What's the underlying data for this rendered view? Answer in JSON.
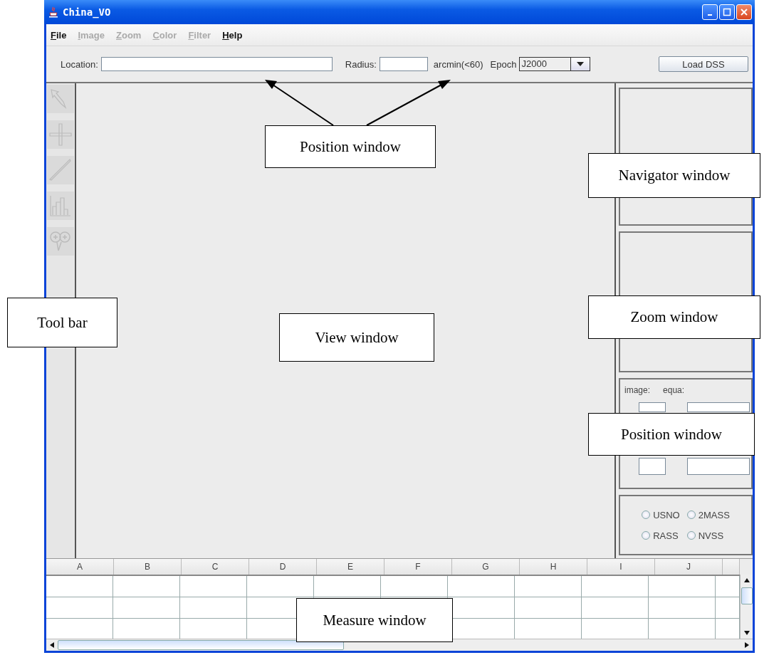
{
  "window": {
    "title": "China_VO"
  },
  "menu": [
    {
      "label": "File",
      "disabled": false
    },
    {
      "label": "Image",
      "disabled": true
    },
    {
      "label": "Zoom",
      "disabled": true
    },
    {
      "label": "Color",
      "disabled": true
    },
    {
      "label": "Filter",
      "disabled": true
    },
    {
      "label": "Help",
      "disabled": false
    }
  ],
  "location_bar": {
    "location_label": "Location:",
    "radius_label": "Radius:",
    "radius_unit": "arcmin(<60)",
    "epoch_label": "Epoch",
    "epoch_value": "J2000",
    "load_button": "Load DSS"
  },
  "tools": [
    {
      "kind": "pointer"
    },
    {
      "kind": "crosshair"
    },
    {
      "kind": "line"
    },
    {
      "kind": "histogram"
    },
    {
      "kind": "zoom"
    }
  ],
  "position_panel": {
    "image_label": "image:",
    "equa_label": "equa:"
  },
  "catalogs": [
    {
      "label": "USNO",
      "selected": false
    },
    {
      "label": "2MASS",
      "selected": false
    },
    {
      "label": "RASS",
      "selected": false
    },
    {
      "label": "NVSS",
      "selected": false
    }
  ],
  "measure_table": {
    "columns": [
      "A",
      "B",
      "C",
      "D",
      "E",
      "F",
      "G",
      "H",
      "I",
      "J"
    ]
  },
  "annotations": [
    {
      "text": "Position window"
    },
    {
      "text": "Navigator window"
    },
    {
      "text": "Tool bar"
    },
    {
      "text": "View window"
    },
    {
      "text": "Zoom window"
    },
    {
      "text": "Position window"
    },
    {
      "text": "Measure window"
    }
  ]
}
